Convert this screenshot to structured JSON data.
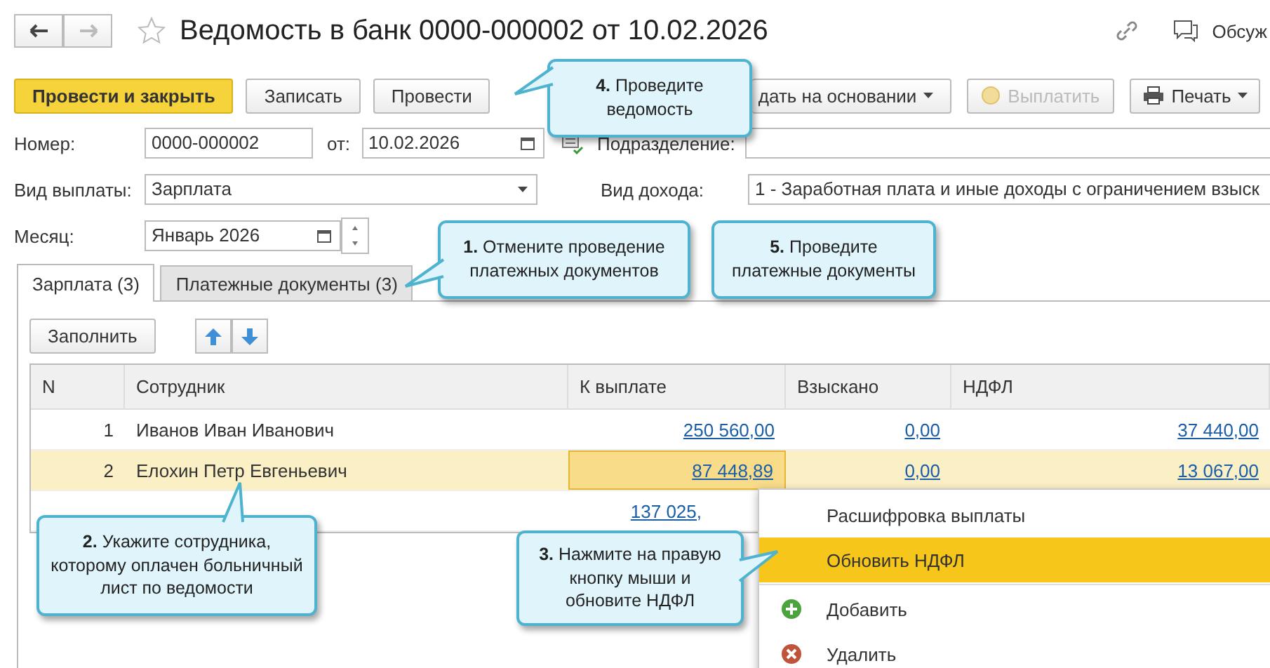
{
  "window": {
    "title": "Ведомость в банк 0000-000002 от 10.02.2026",
    "discuss": "Обсуж"
  },
  "toolbar": [
    {
      "label": "Провести и закрыть",
      "kind": "primary",
      "disabled": false
    },
    {
      "label": "Записать",
      "kind": "plain",
      "disabled": false
    },
    {
      "label": "Провести",
      "kind": "plain",
      "disabled": false
    },
    {
      "label": "дать на основании",
      "kind": "dropdown",
      "disabled": false
    },
    {
      "label": "Выплатить",
      "kind": "coin",
      "disabled": true
    },
    {
      "label": "Печать",
      "kind": "print",
      "disabled": false
    }
  ],
  "fields": {
    "number_label": "Номер:",
    "number": "0000-000002",
    "date_label": "от:",
    "date": "10.02.2026",
    "department_label": "Подразделение:",
    "payment_type_label": "Вид выплаты:",
    "payment_type": "Зарплата",
    "income_type_label": "Вид дохода:",
    "income_type": "1 - Заработная плата и иные доходы с ограничением взыск",
    "month_label": "Месяц:",
    "month": "Январь 2026"
  },
  "tabs": [
    {
      "label": "Зарплата (3)",
      "selected": true
    },
    {
      "label": "Платежные документы (3)",
      "selected": false
    }
  ],
  "fill_button": "Заполнить",
  "table": {
    "columns": [
      "N",
      "Сотрудник",
      "К выплате",
      "Взыскано",
      "НДФЛ"
    ],
    "rows": [
      {
        "n": "1",
        "employee": "Иванов Иван Иванович",
        "payout": "250 560,00",
        "recovered": "0,00",
        "ndfl": "37 440,00",
        "selected": false
      },
      {
        "n": "2",
        "employee": "Елохин Петр Евгеньевич",
        "payout": "87 448,89",
        "recovered": "0,00",
        "ndfl": "13 067,00",
        "selected": true
      },
      {
        "payout": "137 025,",
        "selected": false
      }
    ]
  },
  "context_menu": [
    {
      "label": "Расшифровка выплаты",
      "kind": "plain",
      "selected": false
    },
    {
      "label": "Обновить НДФЛ",
      "kind": "plain",
      "selected": true
    },
    {
      "label": "Добавить",
      "kind": "add",
      "selected": false
    },
    {
      "label": "Удалить",
      "kind": "delete",
      "selected": false
    }
  ],
  "callouts": [
    {
      "text": "**4.** Проведите ведомость"
    },
    {
      "text": "**1.** Отмените проведение платежных документов"
    },
    {
      "text": "**5.** Проведите платежные документы"
    },
    {
      "text": "**2.** Укажите сотрудника, которому оплачен больничный лист по ведомости"
    },
    {
      "text": "**3.** Нажмите на правую кнопку мыши и обновите НДФЛ"
    }
  ]
}
